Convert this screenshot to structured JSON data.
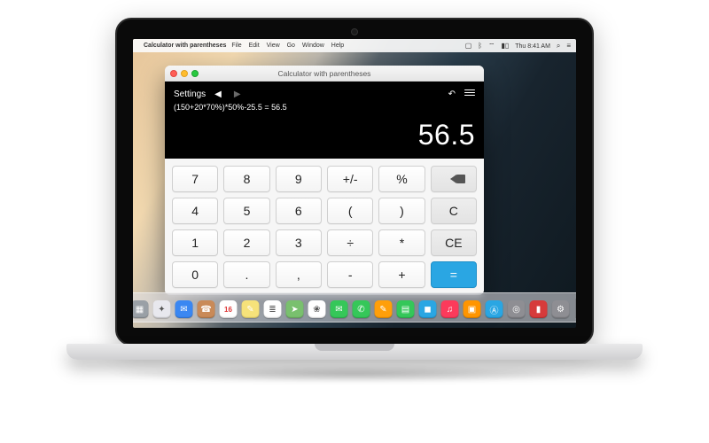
{
  "menubar": {
    "app_name": "Calculator with parentheses",
    "menus": [
      "File",
      "Edit",
      "View",
      "Go",
      "Window",
      "Help"
    ],
    "status": {
      "time": "Thu 8:41 AM"
    }
  },
  "window": {
    "title": "Calculator with parentheses"
  },
  "calc": {
    "settings_label": "Settings",
    "expression": "(150+20*70%)*50%-25.5 = 56.5",
    "result": "56.5",
    "keys": {
      "r0": [
        "7",
        "8",
        "9",
        "+/-",
        "%"
      ],
      "r1": [
        "4",
        "5",
        "6",
        "(",
        ")",
        "C"
      ],
      "r2": [
        "1",
        "2",
        "3",
        "÷",
        "*",
        "CE"
      ],
      "r3": [
        "0",
        ".",
        ",",
        "-",
        "+",
        "="
      ]
    },
    "backspace_label": "backspace",
    "clear_label": "C",
    "clear_entry_label": "CE",
    "equals_label": "="
  },
  "dock": {
    "items": [
      {
        "name": "finder",
        "color": "#2aa6e3",
        "glyph": "☺"
      },
      {
        "name": "launchpad",
        "color": "#9aa0a6",
        "glyph": "▦"
      },
      {
        "name": "safari",
        "color": "#e8e8ee",
        "glyph": "✦"
      },
      {
        "name": "mail",
        "color": "#3a87f2",
        "glyph": "✉"
      },
      {
        "name": "contacts",
        "color": "#c98a58",
        "glyph": "☎"
      },
      {
        "name": "calendar",
        "color": "#ffffff",
        "glyph": "16"
      },
      {
        "name": "notes",
        "color": "#f6e27a",
        "glyph": "✎"
      },
      {
        "name": "reminders",
        "color": "#ffffff",
        "glyph": "≣"
      },
      {
        "name": "maps",
        "color": "#79c06e",
        "glyph": "➤"
      },
      {
        "name": "photos",
        "color": "#ffffff",
        "glyph": "❀"
      },
      {
        "name": "messages",
        "color": "#35c759",
        "glyph": "✉"
      },
      {
        "name": "facetime",
        "color": "#35c759",
        "glyph": "✆"
      },
      {
        "name": "pages",
        "color": "#ff9f0a",
        "glyph": "✎"
      },
      {
        "name": "numbers",
        "color": "#34c759",
        "glyph": "▤"
      },
      {
        "name": "keynote",
        "color": "#2aa6e3",
        "glyph": "◼"
      },
      {
        "name": "itunes",
        "color": "#fc3a5b",
        "glyph": "♫"
      },
      {
        "name": "ibooks",
        "color": "#ff9500",
        "glyph": "▣"
      },
      {
        "name": "appstore",
        "color": "#2aa6e3",
        "glyph": "Ⓐ"
      },
      {
        "name": "preview",
        "color": "#8e8e93",
        "glyph": "◎"
      },
      {
        "name": "dictionary",
        "color": "#d63b3b",
        "glyph": "▮"
      },
      {
        "name": "systemprefs",
        "color": "#8e8e93",
        "glyph": "⚙"
      }
    ],
    "trash": {
      "name": "trash",
      "glyph": "🗑"
    }
  }
}
